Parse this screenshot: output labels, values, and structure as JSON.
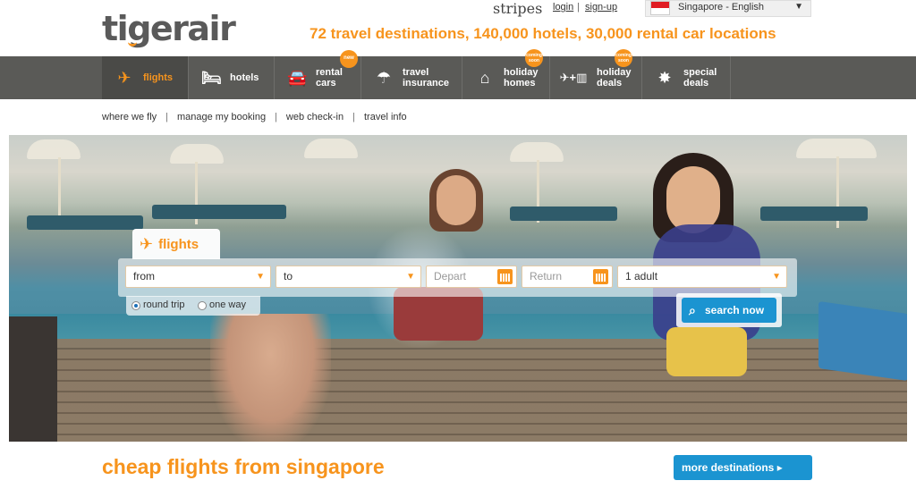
{
  "header": {
    "logo": "tigerair",
    "partner": "stripes",
    "login": "login",
    "separator": "|",
    "signup": "sign-up",
    "language": "Singapore - English",
    "tagline": "72 travel destinations, 140,000 hotels, 30,000 rental car locations"
  },
  "nav": {
    "items": [
      {
        "label": "flights",
        "icon": "plane-icon"
      },
      {
        "label": "hotels",
        "icon": "bed-icon"
      },
      {
        "label": "rental cars",
        "icon": "car-icon",
        "badge": "new"
      },
      {
        "label": "travel insurance",
        "icon": "umbrella-icon"
      },
      {
        "label": "holiday homes",
        "icon": "house-icon",
        "badge": "coming soon"
      },
      {
        "label": "holiday deals",
        "icon": "plane-hotel-icon",
        "badge": "coming soon"
      },
      {
        "label": "special deals",
        "icon": "star-burst-icon"
      }
    ]
  },
  "subnav": [
    "where we fly",
    "manage my booking",
    "web check-in",
    "travel info"
  ],
  "search": {
    "tab_label": "flights",
    "from": "from",
    "to": "to",
    "depart": "Depart",
    "return": "Return",
    "passengers": "1 adult",
    "round_trip": "round trip",
    "one_way": "one way",
    "selected_trip": "round trip",
    "button": "search now"
  },
  "bottom": {
    "heading": "cheap flights from singapore",
    "more_button": "more destinations ▸"
  },
  "colors": {
    "brand_orange": "#f7941d",
    "nav_gray": "#5a5a57",
    "action_blue": "#1b94d1"
  }
}
